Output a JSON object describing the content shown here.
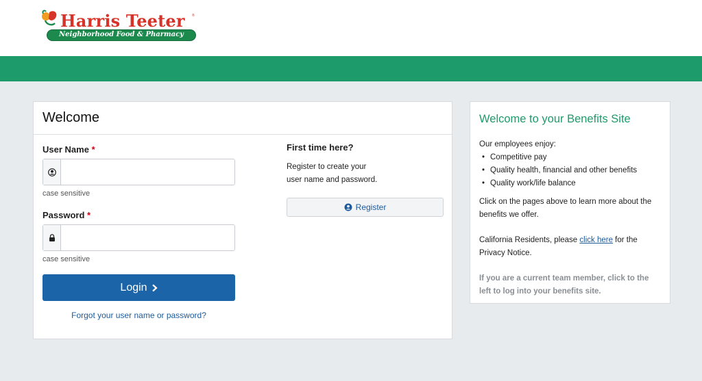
{
  "brand": {
    "name": "Harris Teeter",
    "registered": "®",
    "tagline": "Neighborhood Food & Pharmacy",
    "red": "#d6342a",
    "green": "#1d8a4d"
  },
  "theme": {
    "accent_green": "#1e9b6a",
    "login_blue": "#1c64a8",
    "link_blue": "#1c5a9a",
    "required_red": "#d0021b"
  },
  "login": {
    "heading": "Welcome",
    "username_label": "User Name",
    "username_value": "",
    "username_icon": "user-circle-icon",
    "password_label": "Password",
    "password_value": "",
    "password_icon": "lock-icon",
    "required_mark": "*",
    "hint": "case sensitive",
    "login_button": "Login",
    "login_icon": "chevron-right-icon",
    "forgot_link": "Forgot your user name or password?"
  },
  "register": {
    "title": "First time here?",
    "line1": "Register to create your",
    "line2": "user name and password.",
    "button": "Register",
    "button_icon": "user-circle-icon"
  },
  "benefits": {
    "title": "Welcome to your Benefits Site",
    "intro": "Our employees enjoy:",
    "items": [
      "Competitive pay",
      "Quality health, financial and other benefits",
      "Quality work/life balance"
    ],
    "pages_text": "Click on the pages above to learn more about the benefits we offer.",
    "ca_prefix": "California Residents, please ",
    "ca_link": "click here",
    "ca_suffix": " for the Privacy Notice.",
    "team_note": "If you are a current team member, click to the left to log into your benefits site."
  }
}
